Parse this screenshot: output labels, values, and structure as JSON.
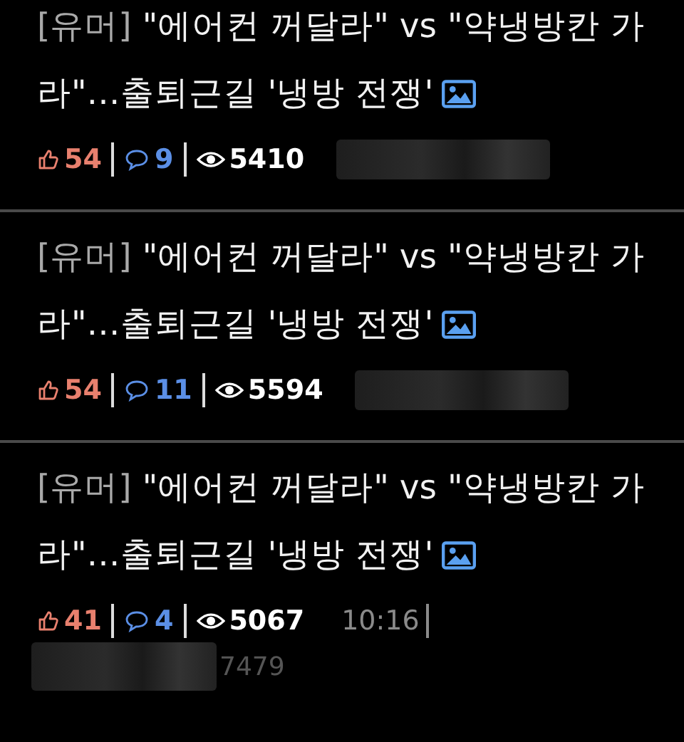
{
  "posts": [
    {
      "category": "[유머]",
      "title": "\"에어컨 꺼달라\" vs \"약냉방칸 가라\"…출퇴근길 '냉방 전쟁'",
      "has_image": true,
      "likes": "54",
      "comments": "9",
      "views": "5410",
      "redacted_inline": true
    },
    {
      "category": "[유머]",
      "title": "\"에어컨 꺼달라\" vs \"약냉방칸 가라\"…출퇴근길 '냉방 전쟁'",
      "has_image": true,
      "likes": "54",
      "comments": "11",
      "views": "5594",
      "redacted_inline": true
    },
    {
      "category": "[유머]",
      "title": "\"에어컨 꺼달라\" vs \"약냉방칸 가라\"…출퇴근길 '냉방 전쟁'",
      "has_image": true,
      "likes": "41",
      "comments": "4",
      "views": "5067",
      "time": "10:16",
      "redacted_below": true,
      "below_text": "7479"
    }
  ]
}
